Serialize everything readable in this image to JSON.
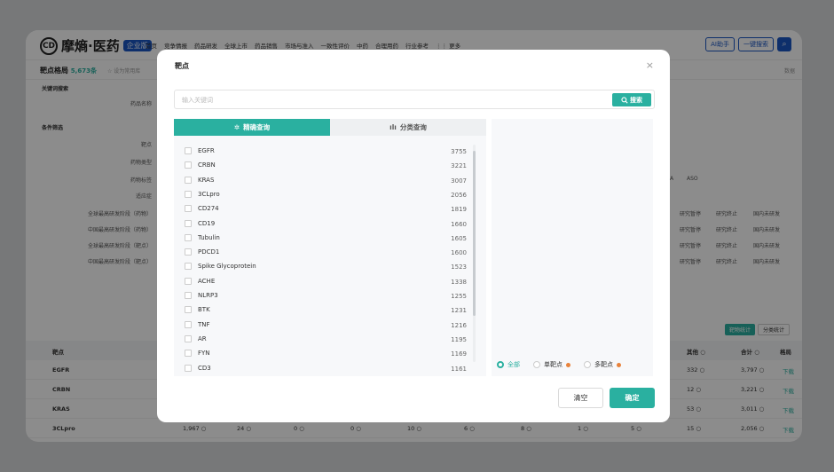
{
  "app": {
    "logo_mark": "CD",
    "logo_text": "摩熵·医药",
    "logo_badge": "企业版",
    "nav": [
      "首页",
      "竞争情报",
      "药品研发",
      "全球上市",
      "药品销售",
      "市场与准入",
      "一致性评价",
      "中药",
      "合理用药",
      "行业参考",
      "⋮⋮ 更多"
    ],
    "ai_button": "AI助手",
    "search_button": "一键搜索",
    "page_title": "靶点格局",
    "page_count": "5,673条",
    "fav_label": "☆ 设为常用库",
    "sub_right": "数据",
    "sections": {
      "keyword": "关键词搜索",
      "drug_name": "药品名称",
      "filter": "条件筛选",
      "target": "靶点",
      "drug_type": "药物类型",
      "drug_tag": "药物标签",
      "indication": "适应症",
      "stage1": "全球最高研发阶段（药物）",
      "stage2": "中国最高研发阶段（药物）",
      "stage3": "全球最高研发阶段（靶点）",
      "stage4": "中国最高研发阶段（靶点）"
    },
    "right_bg": {
      "asa": "A",
      "aso": "ASO",
      "paused": "研究暂停",
      "stopped": "研究终止",
      "not_dev": "国内未研发"
    },
    "stats": {
      "on": "靶物统计",
      "off": "分类统计"
    },
    "table": {
      "headers": {
        "target": "靶点",
        "other": "其他 ○",
        "total": "合计 ○",
        "pattern": "格局"
      },
      "rows": [
        {
          "name": "EGFR",
          "other": "332 ○",
          "total": "3,797 ○",
          "link": "下载"
        },
        {
          "name": "CRBN",
          "other": "12 ○",
          "total": "3,221 ○",
          "link": "下载"
        },
        {
          "name": "KRAS",
          "other": "53 ○",
          "total": "3,011 ○",
          "link": "下载"
        },
        {
          "name": "3CLpro",
          "other": "15 ○",
          "total": "2,056 ○",
          "link": "下载",
          "c1": "1,967 ○",
          "c2": "24 ○",
          "c3": "0 ○",
          "c4": "0 ○",
          "c5": "10 ○",
          "c6": "6 ○",
          "c7": "8 ○",
          "c8": "1 ○",
          "c9": "5 ○"
        }
      ]
    }
  },
  "modal": {
    "title": "靶点",
    "close_icon": "×",
    "search": {
      "placeholder": "输入关键词",
      "button": "搜索"
    },
    "tabs": {
      "precise": "精确查询",
      "category": "分类查询"
    },
    "items": [
      {
        "name": "EGFR",
        "count": "3755"
      },
      {
        "name": "CRBN",
        "count": "3221"
      },
      {
        "name": "KRAS",
        "count": "3007"
      },
      {
        "name": "3CLpro",
        "count": "2056"
      },
      {
        "name": "CD274",
        "count": "1819"
      },
      {
        "name": "CD19",
        "count": "1660"
      },
      {
        "name": "Tubulin",
        "count": "1605"
      },
      {
        "name": "PDCD1",
        "count": "1600"
      },
      {
        "name": "Spike Glycoprotein",
        "count": "1523"
      },
      {
        "name": "ACHE",
        "count": "1338"
      },
      {
        "name": "NLRP3",
        "count": "1255"
      },
      {
        "name": "BTK",
        "count": "1231"
      },
      {
        "name": "TNF",
        "count": "1216"
      },
      {
        "name": "AR",
        "count": "1195"
      },
      {
        "name": "FYN",
        "count": "1169"
      },
      {
        "name": "CD3",
        "count": "1161"
      }
    ],
    "radios": {
      "all": "全部",
      "single": "单靶点",
      "multi": "多靶点"
    },
    "buttons": {
      "clear": "清空",
      "ok": "确定"
    }
  }
}
